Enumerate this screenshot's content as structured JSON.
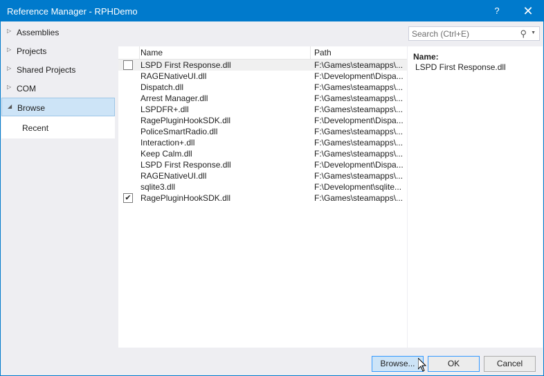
{
  "window": {
    "title": "Reference Manager - RPHDemo",
    "help": "?",
    "close": "✕"
  },
  "nav": {
    "items": [
      {
        "label": "Assemblies",
        "arrow": "▷"
      },
      {
        "label": "Projects",
        "arrow": "▷"
      },
      {
        "label": "Shared Projects",
        "arrow": "▷"
      },
      {
        "label": "COM",
        "arrow": "▷"
      },
      {
        "label": "Browse",
        "arrow": "◢"
      }
    ],
    "sub": "Recent"
  },
  "search": {
    "placeholder": "Search (Ctrl+E)",
    "icon": "⚲",
    "dropdown": "▼"
  },
  "table": {
    "headers": {
      "name": "Name",
      "path": "Path"
    },
    "rows": [
      {
        "name": "LSPD First Response.dll",
        "path": "F:\\Games\\steamapps\\...",
        "check": ""
      },
      {
        "name": "RAGENativeUI.dll",
        "path": "F:\\Development\\Dispa...",
        "check": ""
      },
      {
        "name": "Dispatch.dll",
        "path": "F:\\Games\\steamapps\\...",
        "check": ""
      },
      {
        "name": "Arrest Manager.dll",
        "path": "F:\\Games\\steamapps\\...",
        "check": ""
      },
      {
        "name": "LSPDFR+.dll",
        "path": "F:\\Games\\steamapps\\...",
        "check": ""
      },
      {
        "name": "RagePluginHookSDK.dll",
        "path": "F:\\Development\\Dispa...",
        "check": ""
      },
      {
        "name": "PoliceSmartRadio.dll",
        "path": "F:\\Games\\steamapps\\...",
        "check": ""
      },
      {
        "name": "Interaction+.dll",
        "path": "F:\\Games\\steamapps\\...",
        "check": ""
      },
      {
        "name": "Keep Calm.dll",
        "path": "F:\\Games\\steamapps\\...",
        "check": ""
      },
      {
        "name": "LSPD First Response.dll",
        "path": "F:\\Development\\Dispa...",
        "check": ""
      },
      {
        "name": "RAGENativeUI.dll",
        "path": "F:\\Games\\steamapps\\...",
        "check": ""
      },
      {
        "name": "sqlite3.dll",
        "path": "F:\\Development\\sqlite...",
        "check": ""
      },
      {
        "name": "RagePluginHookSDK.dll",
        "path": "F:\\Games\\steamapps\\...",
        "check": "✔"
      }
    ]
  },
  "detail": {
    "label": "Name:",
    "value": "LSPD First Response.dll"
  },
  "buttons": {
    "browse": "Browse...",
    "ok": "OK",
    "cancel": "Cancel"
  }
}
